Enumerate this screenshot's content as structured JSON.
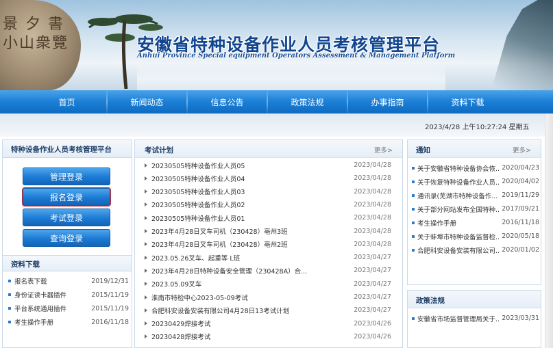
{
  "banner": {
    "title_cn": "安徽省特种设备作业人员考核管理平台",
    "title_en": "Anhui Province Special equipment Operators Assessment & Management Platform",
    "rock_text": "景 夕 書 小山衆覽"
  },
  "nav": {
    "items": [
      {
        "label": "首页"
      },
      {
        "label": "新闻动态"
      },
      {
        "label": "信息公告"
      },
      {
        "label": "政策法规"
      },
      {
        "label": "办事指南"
      },
      {
        "label": "资料下载"
      }
    ]
  },
  "datetime": "2023/4/28 上午10:27:24 星期五",
  "left": {
    "title": "特种设备作业人员考核管理平台",
    "buttons": [
      {
        "label": "管理登录"
      },
      {
        "label": "报名登录"
      },
      {
        "label": "考试登录"
      },
      {
        "label": "查询登录"
      }
    ],
    "downloads_title": "资料下载",
    "downloads": [
      {
        "title": "报名表下载",
        "date": "2019/12/31"
      },
      {
        "title": "身份证读卡器插件",
        "date": "2015/11/19"
      },
      {
        "title": "平台系统通用插件",
        "date": "2015/11/19"
      },
      {
        "title": "考生操作手册",
        "date": "2016/11/18"
      }
    ]
  },
  "exam_plan": {
    "title": "考试计划",
    "more": "更多>",
    "rows": [
      {
        "title": "20230505特种设备作业人员05",
        "date": "2023/04/28"
      },
      {
        "title": "20230505特种设备作业人员04",
        "date": "2023/04/28"
      },
      {
        "title": "20230505特种设备作业人员03",
        "date": "2023/04/28"
      },
      {
        "title": "20230505特种设备作业人员02",
        "date": "2023/04/28"
      },
      {
        "title": "20230505特种设备作业人员01",
        "date": "2023/04/28"
      },
      {
        "title": "2023年4月28日叉车司机（230428）亳州3班",
        "date": "2023/04/28"
      },
      {
        "title": "2023年4月28日叉车司机（230428）亳州2班",
        "date": "2023/04/28"
      },
      {
        "title": "2023.05.26叉车、起重等 L班",
        "date": "2023/04/27"
      },
      {
        "title": "2023年4月28日特种设备安全管理（230428A）合...",
        "date": "2023/04/27"
      },
      {
        "title": "2023.05.09叉车",
        "date": "2023/04/27"
      },
      {
        "title": "淮南市特检中心2023-05-09考试",
        "date": "2023/04/27"
      },
      {
        "title": "合肥科安设备安装有限公司4月28日13考试计划",
        "date": "2023/04/27"
      },
      {
        "title": "20230429焊接考试",
        "date": "2023/04/26"
      },
      {
        "title": "20230428焊接考试",
        "date": "2023/04/26"
      }
    ]
  },
  "notice": {
    "title": "通知",
    "more": "更多>",
    "rows": [
      {
        "title": "关于安徽省特种设备协会恢...",
        "date": "2020/04/23"
      },
      {
        "title": "关于恢复特种设备作业人员...",
        "date": "2020/04/02"
      },
      {
        "title": "通讯录(芜湖市特种设备作...",
        "date": "2019/11/29"
      },
      {
        "title": "关于部分网站发布全国特种...",
        "date": "2017/09/21"
      },
      {
        "title": "考生操作手册",
        "date": "2016/11/18"
      },
      {
        "title": "关于蚌埠市特种设备监督检...",
        "date": "2020/05/18"
      },
      {
        "title": "合肥科安设备安装有限公司...",
        "date": "2020/01/02"
      }
    ]
  },
  "policy": {
    "title": "政策法规",
    "rows": [
      {
        "title": "安徽省市场监督管理局关于...",
        "date": "2023/03/31"
      }
    ]
  }
}
